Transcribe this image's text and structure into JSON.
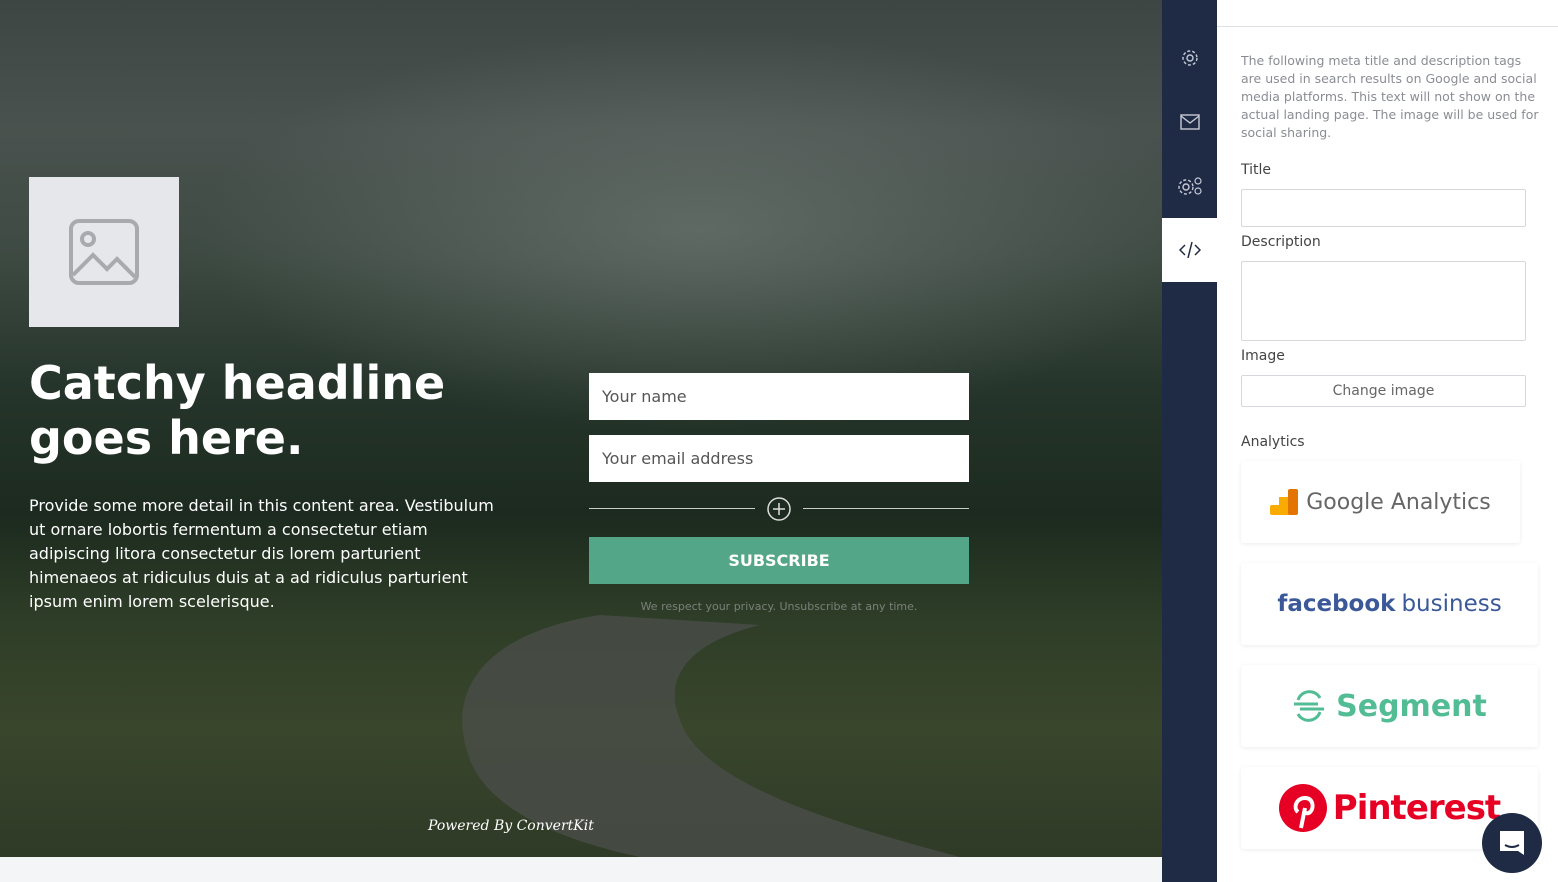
{
  "landing": {
    "headline": "Catchy headline goes here.",
    "detail": "Provide some more detail in this content area. Vestibulum ut ornare lobortis fermentum a consectetur etiam adipiscing litora consectetur dis lorem parturient himenaeos at ridiculus duis at a ad ridiculus parturient ipsum enim lorem scelerisque.",
    "name_placeholder": "Your name",
    "email_placeholder": "Your email address",
    "subscribe_label": "SUBSCRIBE",
    "privacy": "We respect your privacy. Unsubscribe at any time.",
    "powered_by": "Powered By ConvertKit",
    "accent": "#54a688"
  },
  "rail": {
    "items": [
      "settings-icon",
      "mail-icon",
      "advanced-settings-icon",
      "code-icon"
    ],
    "active": "code-icon",
    "color": "#1f2a44"
  },
  "panel": {
    "intro": "The following meta title and description tags are used in search results on Google and social media platforms. This text will not show on the actual landing page. The image will be used for social sharing.",
    "title_label": "Title",
    "title_value": "",
    "description_label": "Description",
    "description_value": "",
    "image_label": "Image",
    "change_image": "Change image",
    "analytics_label": "Analytics",
    "integrations": [
      {
        "name": "Google Analytics"
      },
      {
        "name": "facebook",
        "suffix": "business"
      },
      {
        "name": "Segment"
      },
      {
        "name": "Pinterest"
      }
    ]
  }
}
